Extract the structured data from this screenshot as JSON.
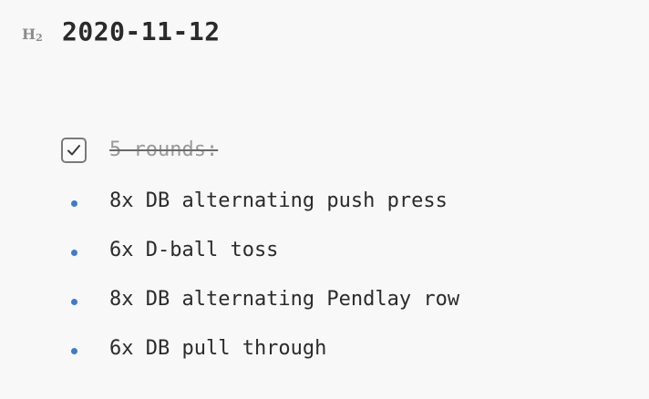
{
  "heading": {
    "level_marker": "H",
    "level_number": "2",
    "title": "2020-11-12"
  },
  "task": {
    "checked": true,
    "text": "5 rounds:"
  },
  "items": [
    {
      "text": "8x DB alternating push press"
    },
    {
      "text": "6x D-ball toss"
    },
    {
      "text": "8x DB alternating Pendlay row"
    },
    {
      "text": "6x DB pull through"
    }
  ],
  "colors": {
    "bullet": "#3d7cc9",
    "marker": "#8d8d8d",
    "strikethrough_text": "#9a9a9a"
  },
  "icons": {
    "checkbox": "checkmark-icon",
    "bullet": "bullet-dot-icon"
  }
}
